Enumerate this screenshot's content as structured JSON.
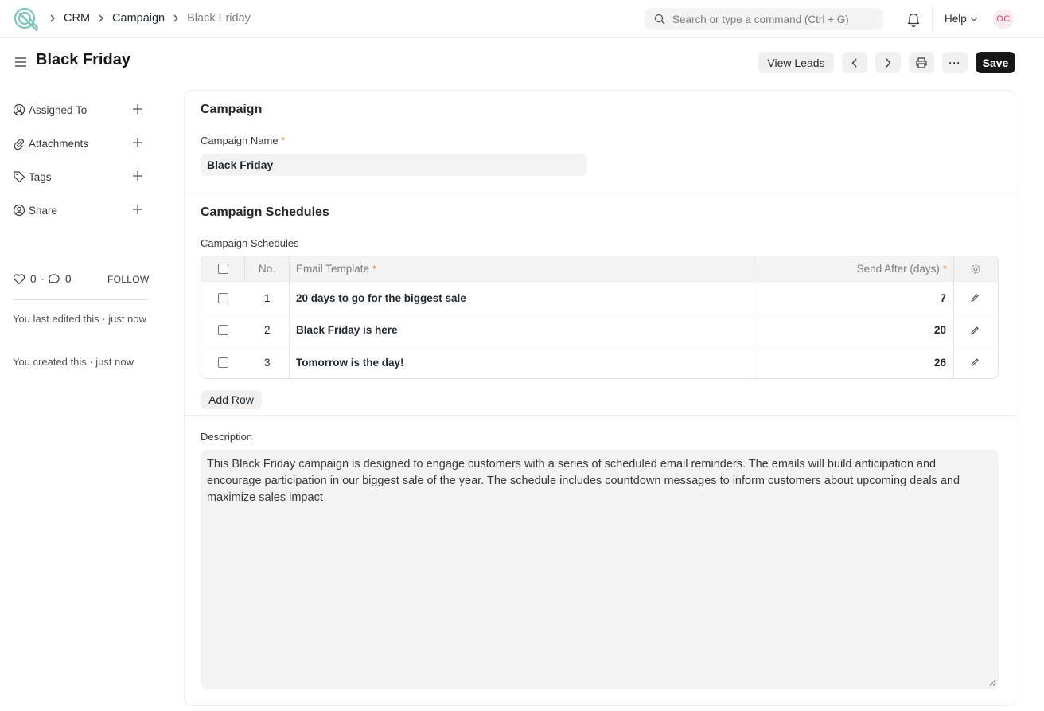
{
  "navbar": {
    "breadcrumbs": [
      "CRM",
      "Campaign",
      "Black Friday"
    ],
    "search_placeholder": "Search or type a command (Ctrl + G)",
    "help_label": "Help",
    "avatar_initials": "OC"
  },
  "header": {
    "title": "Black Friday",
    "view_leads_label": "View Leads",
    "more_label": "···",
    "save_label": "Save"
  },
  "sidebar": {
    "items": [
      {
        "label": "Assigned To",
        "icon": "user-circle-icon"
      },
      {
        "label": "Attachments",
        "icon": "paperclip-icon"
      },
      {
        "label": "Tags",
        "icon": "tag-icon"
      },
      {
        "label": "Share",
        "icon": "user-share-icon"
      }
    ],
    "likes": "0",
    "comments": "0",
    "follow_label": "FOLLOW",
    "last_edited": "You last edited this · just now",
    "created": "You created this · just now"
  },
  "form": {
    "section1_title": "Campaign",
    "campaign_name_label": "Campaign Name",
    "campaign_name_value": "Black Friday",
    "section2_title": "Campaign Schedules",
    "schedules_label": "Campaign Schedules",
    "table": {
      "columns": [
        "No.",
        "Email Template",
        "Send After (days)"
      ],
      "rows": [
        {
          "no": "1",
          "template": "20 days to go for the biggest sale",
          "days": "7"
        },
        {
          "no": "2",
          "template": "Black Friday is here",
          "days": "20"
        },
        {
          "no": "3",
          "template": "Tomorrow is the day!",
          "days": "26"
        }
      ]
    },
    "add_row_label": "Add Row",
    "description_label": "Description",
    "description_value": "This Black Friday campaign is designed to engage customers with a series of scheduled email reminders. The emails will build anticipation and encourage participation in our biggest sale of the year. The schedule includes countdown messages to inform customers about upcoming deals and maximize sales impact"
  },
  "colors": {
    "accent": "#171717",
    "required": "#e8833a",
    "logo": "#5bb8b0",
    "avatar_text": "#e03c68"
  }
}
